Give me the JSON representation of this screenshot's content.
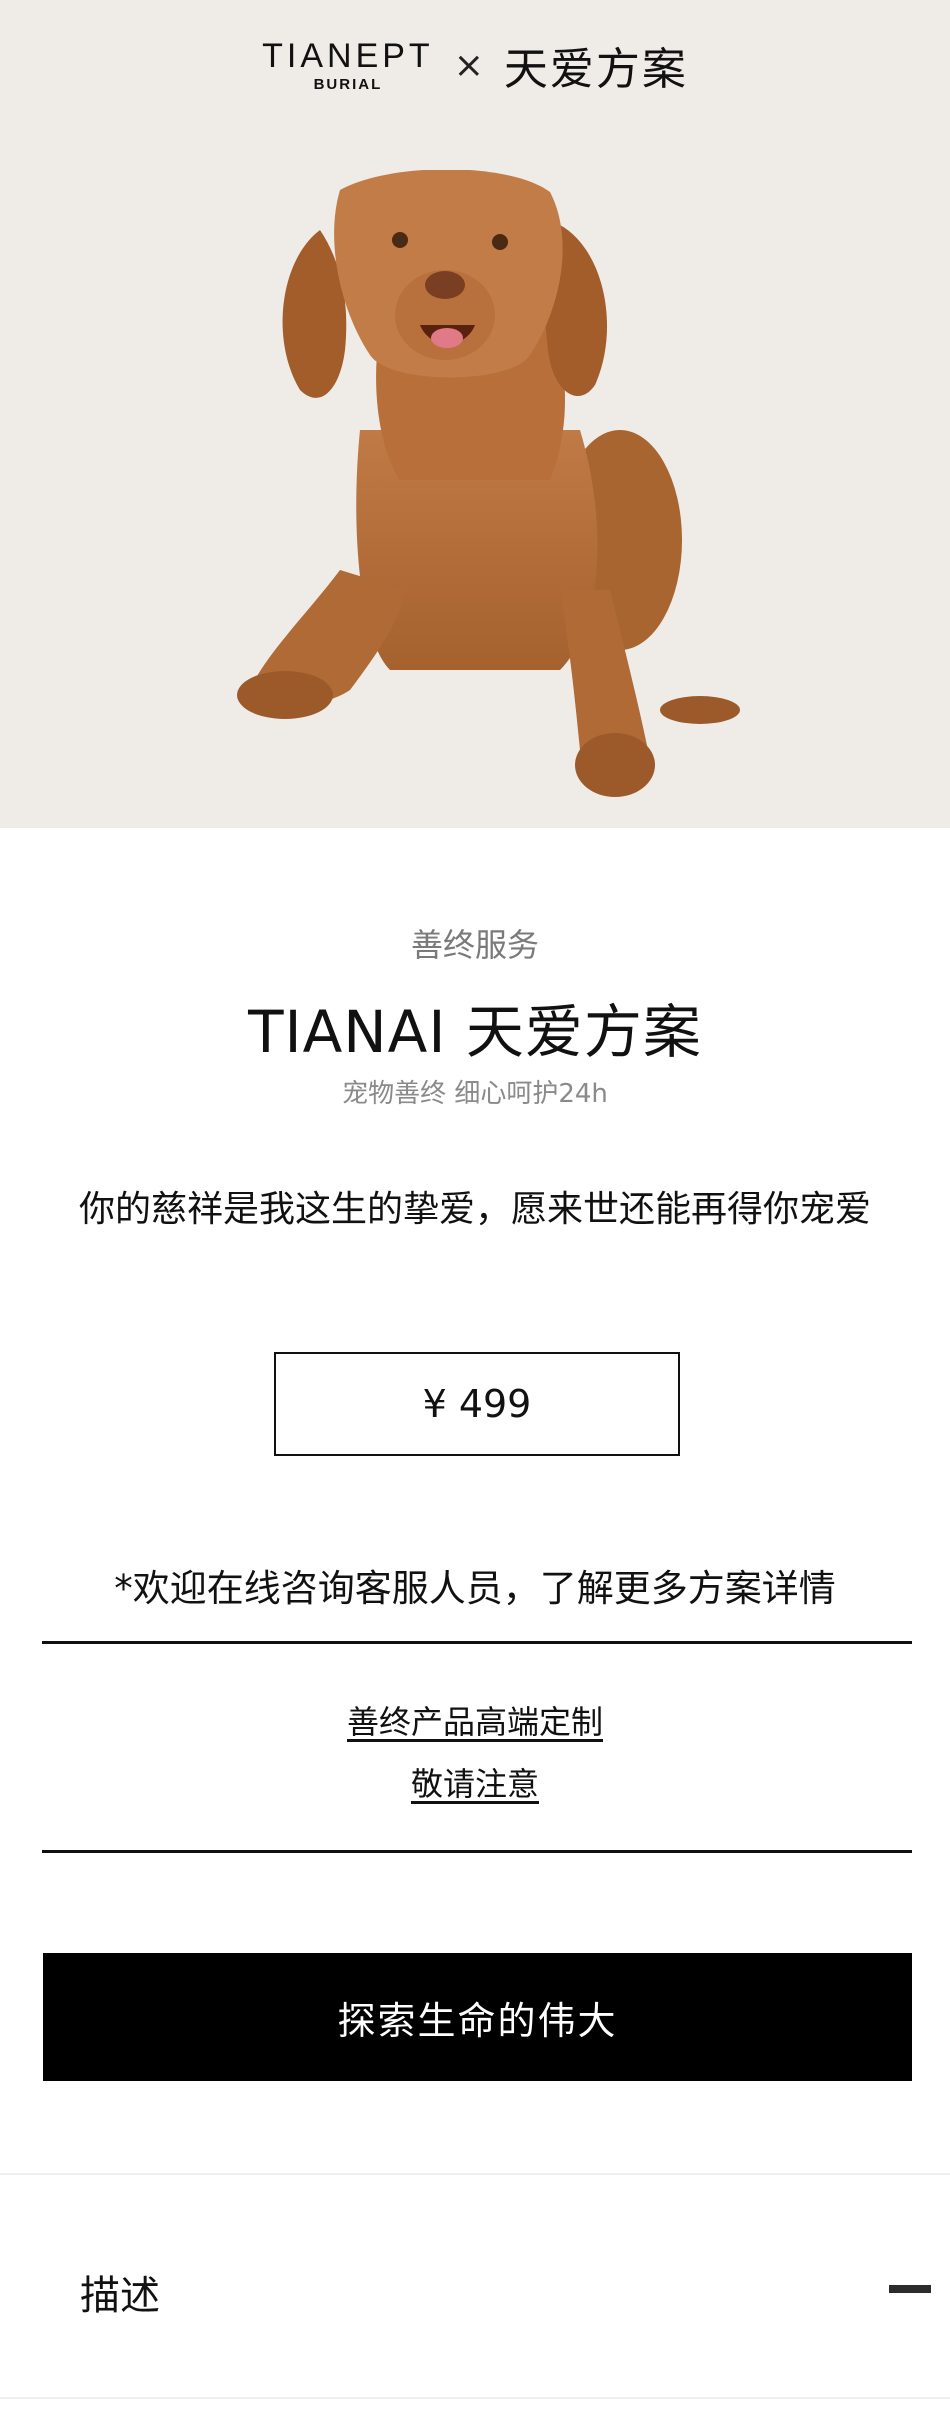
{
  "header": {
    "brand_name": "TIANEPT",
    "brand_sub": "BURIAL",
    "separator": "×",
    "title": "天爱方案"
  },
  "product": {
    "category": "善终服务",
    "title": "TIANAI 天爱方案",
    "subtitle": "宠物善终 细心呵护24h",
    "tagline": "你的慈祥是我这生的挚爱，愿来世还能再得你宠爱",
    "currency": "¥",
    "price": "499",
    "consult_note": "*欢迎在线咨询客服人员，了解更多方案详情",
    "links": [
      "善终产品高端定制",
      "敬请注意"
    ],
    "cta_label": "探索生命的伟大"
  },
  "accordion": {
    "label": "描述",
    "state_icon": "minus-icon"
  },
  "colors": {
    "hero_background": "#efebe7",
    "cta_background": "#000000",
    "cta_text": "#ffffff",
    "muted_text": "#7a7a7a"
  }
}
